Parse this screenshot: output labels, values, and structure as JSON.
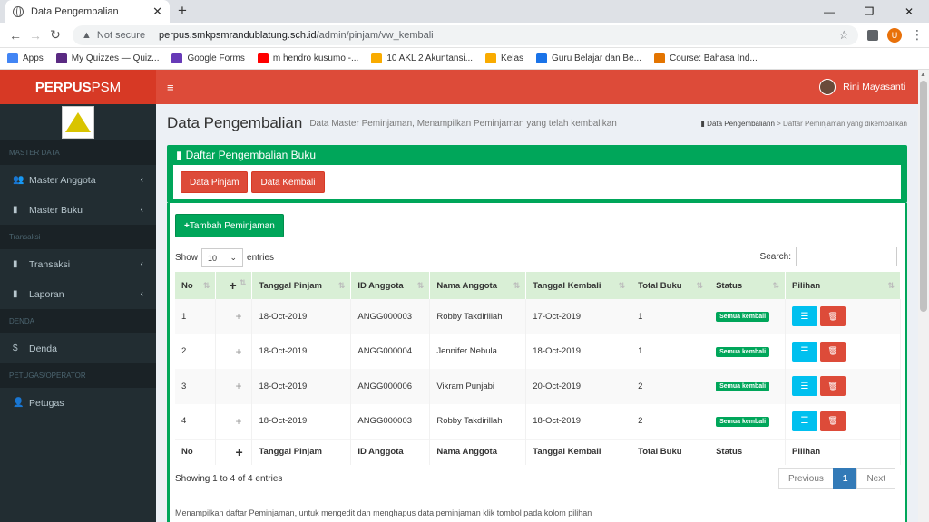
{
  "browser": {
    "tab_title": "Data Pengembalian",
    "not_secure": "Not secure",
    "url_host": "perpus.smkpsmrandublatung.sch.id",
    "url_path": "/admin/pinjam/vw_kembali",
    "profile_letter": "U",
    "bookmarks": [
      {
        "label": "Apps",
        "color": "#4285f4"
      },
      {
        "label": "My Quizzes — Quiz...",
        "color": "#5a2a82"
      },
      {
        "label": "Google Forms",
        "color": "#673ab7"
      },
      {
        "label": "m hendro kusumo -...",
        "color": "#ff0000"
      },
      {
        "label": "10 AKL 2 Akuntansi...",
        "color": "#f9ab00"
      },
      {
        "label": "Kelas",
        "color": "#f9ab00"
      },
      {
        "label": "Guru Belajar dan Be...",
        "color": "#1a73e8"
      },
      {
        "label": "Course: Bahasa Ind...",
        "color": "#e37400"
      }
    ]
  },
  "app": {
    "brand_bold": "PERPUS",
    "brand_rest": " PSM",
    "user_name": "Rini Mayasanti"
  },
  "sidebar": {
    "sections": [
      {
        "header": "MASTER DATA",
        "items": [
          {
            "label": "Master Anggota",
            "icon": "users-icon",
            "glyph": "👥",
            "chevron": true
          },
          {
            "label": "Master Buku",
            "icon": "book-icon",
            "glyph": "▮",
            "chevron": true
          }
        ]
      },
      {
        "header": "Transaksi",
        "items": [
          {
            "label": "Transaksi",
            "icon": "book-icon",
            "glyph": "▮",
            "chevron": true
          },
          {
            "label": "Laporan",
            "icon": "book-icon",
            "glyph": "▮",
            "chevron": true
          }
        ]
      },
      {
        "header": "DENDA",
        "items": [
          {
            "label": "Denda",
            "icon": "dollar-icon",
            "glyph": "$",
            "chevron": false
          }
        ]
      },
      {
        "header": "PETUGAS/OPERATOR",
        "items": [
          {
            "label": "Petugas",
            "icon": "user-plus-icon",
            "glyph": "👤",
            "chevron": false
          }
        ]
      }
    ]
  },
  "page": {
    "title": "Data Pengembalian",
    "subtitle": "Data Master Peminjaman, Menampilkan Peminjaman yang telah kembalikan",
    "breadcrumb_1": "Data Pengembaliann",
    "breadcrumb_sep": ">",
    "breadcrumb_2": "Daftar Peminjaman yang dikembalikan",
    "box_title": "Daftar Pengembalian Buku",
    "btn_pinjam": "Data Pinjam",
    "btn_kembali": "Data Kembali",
    "btn_tambah": "Tambah Peminjaman",
    "show_label": "Show",
    "entries_value": "10",
    "entries_label": "entries",
    "search_label": "Search:",
    "showing": "Showing 1 to 4 of 4 entries",
    "prev": "Previous",
    "page_num": "1",
    "next": "Next",
    "footnote": "Menampilkan daftar Peminjaman, untuk mengedit dan menghapus data peminjaman klik tombol pada kolom pilihan"
  },
  "table": {
    "headers": [
      "No",
      "+",
      "Tanggal Pinjam",
      "ID Anggota",
      "Nama Anggota",
      "Tanggal Kembali",
      "Total Buku",
      "Status",
      "Pilihan"
    ],
    "rows": [
      [
        "1",
        "+",
        "18-Oct-2019",
        "ANGG000003",
        "Robby Takdirillah",
        "17-Oct-2019",
        "1",
        "Semua kembali"
      ],
      [
        "2",
        "+",
        "18-Oct-2019",
        "ANGG000004",
        "Jennifer Nebula",
        "18-Oct-2019",
        "1",
        "Semua kembali"
      ],
      [
        "3",
        "+",
        "18-Oct-2019",
        "ANGG000006",
        "Vikram Punjabi",
        "20-Oct-2019",
        "2",
        "Semua kembali"
      ],
      [
        "4",
        "+",
        "18-Oct-2019",
        "ANGG000003",
        "Robby Takdirillah",
        "18-Oct-2019",
        "2",
        "Semua kembali"
      ]
    ]
  }
}
